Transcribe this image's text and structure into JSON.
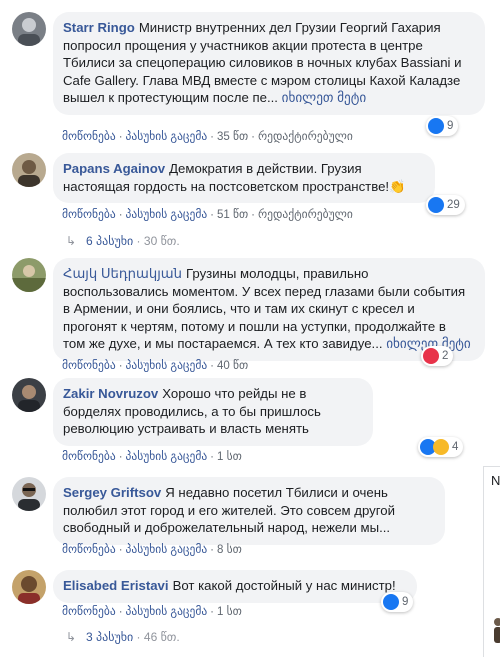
{
  "comments": [
    {
      "author": "Starr Ringo",
      "text": "Министр внутренних дел Грузии Георгий Гахария попросил прощения у участников акции протеста в центре Тбилиси за спецоперацию силовиков в ночных клубах Bassiani и Cafe Gallery. Глава МВД вместе с мэром столицы Кахой Каладзе вышел к протестующим после пе...",
      "see_more": "იხილეთ მეტი",
      "like": "მოწონება",
      "reply": "პასუხის გაცემა",
      "time": "35 წთ",
      "edited": "რედაქტირებული",
      "reactions": "9"
    },
    {
      "author": "Papans Againov",
      "text": "Демократия в действии. Грузия настоящая гордость на постсоветском пространстве!",
      "like": "მოწონება",
      "reply": "პასუხის გაცემა",
      "time": "51 წთ",
      "edited": "რედაქტირებული",
      "reactions": "29",
      "replies_label": "6 პასუხი",
      "replies_time": "30 წთ."
    },
    {
      "author": "Հայկ Սեդրակյան",
      "text": "Грузины молодцы, правильно воспользовались моментом. У всех перед глазами были события в Армении, и они боялись, что и там их скинут с кресел и прогонят к чертям, потому и пошли на уступки, продолжайте в том же духе, и мы постараемся. А тех кто завидуе...",
      "see_more": "იხილეთ მეტი",
      "like": "მოწონება",
      "reply": "პასუხის გაცემა",
      "time": "40 წთ",
      "reactions": "2"
    },
    {
      "author": "Zakir Novruzov",
      "text": "Хорошо что рейды не в борделях проводились, а то бы пришлось революцию устраивать и власть менять",
      "like": "მოწონება",
      "reply": "პასუხის გაცემა",
      "time": "1 სთ",
      "reactions": "4"
    },
    {
      "author": "Sergey Griftsov",
      "text": "Я недавно посетил Тбилиси и очень полюбил этот город и его жителей. Это совсем другой свободный и доброжелательный народ, нежели мы...",
      "see_more": "",
      "like": "მოწონება",
      "reply": "პასუხის გაცემა",
      "time": "8 სთ"
    },
    {
      "author": "Elisabed Eristavi",
      "text": "Вот какой достойный у нас министр!",
      "like": "მოწონება",
      "reply": "პასუხის გაცემა",
      "time": "1 სთ",
      "reactions": "9",
      "replies_label": "3 პასუხი",
      "replies_time": "46 წთ."
    }
  ],
  "side_panel": {
    "letter": "N"
  },
  "colors": {
    "link": "#385898",
    "bubble": "#f2f3f5",
    "like_blue": "#1877f2",
    "love_red": "#e8334a",
    "haha_yellow": "#f7b928"
  }
}
